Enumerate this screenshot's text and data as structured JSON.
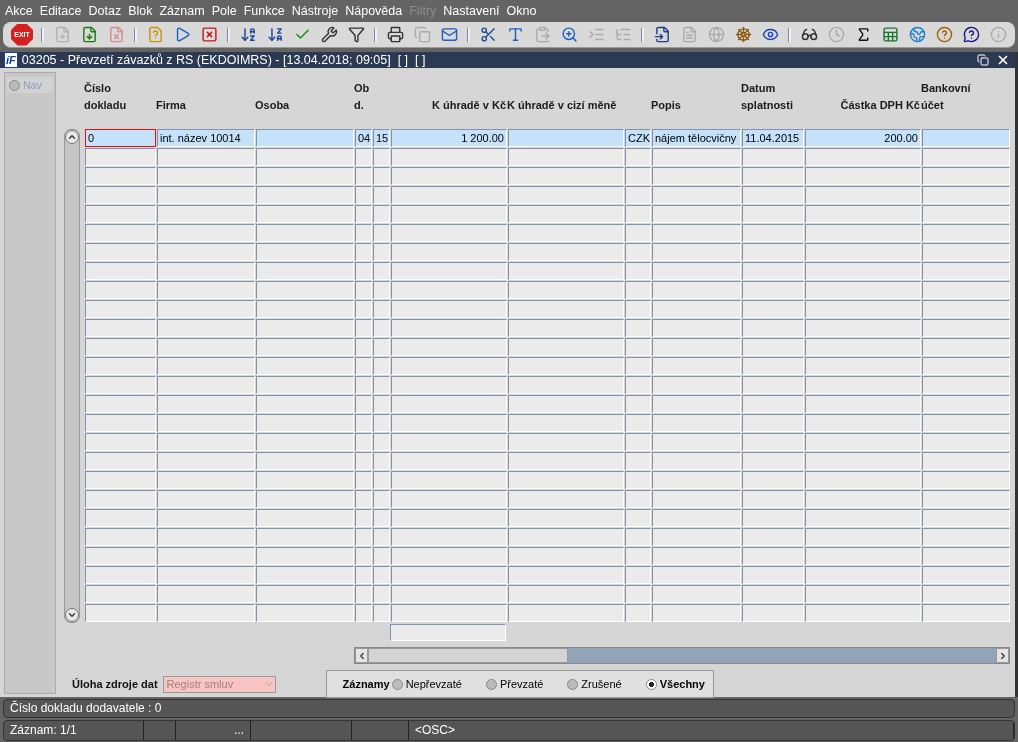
{
  "menu": [
    {
      "label": "Akce",
      "disabled": false
    },
    {
      "label": "Editace",
      "disabled": false
    },
    {
      "label": "Dotaz",
      "disabled": false
    },
    {
      "label": "Blok",
      "disabled": false
    },
    {
      "label": "Záznam",
      "disabled": false
    },
    {
      "label": "Pole",
      "disabled": false
    },
    {
      "label": "Funkce",
      "disabled": false
    },
    {
      "label": "Nástroje",
      "disabled": false
    },
    {
      "label": "Nápověda",
      "disabled": false
    },
    {
      "label": "Filtry",
      "disabled": true
    },
    {
      "label": "Nastavení",
      "disabled": false
    },
    {
      "label": "Okno",
      "disabled": false
    }
  ],
  "toolbar": [
    [
      {
        "kind": "exit",
        "label": "EXIT",
        "disabled": false
      }
    ],
    [
      {
        "kind": "insert",
        "disabled": true
      },
      {
        "kind": "save",
        "disabled": false
      },
      {
        "kind": "delete",
        "disabled": true
      }
    ],
    [
      {
        "kind": "query-enter",
        "disabled": false
      },
      {
        "kind": "query-execute",
        "disabled": false
      },
      {
        "kind": "query-cancel",
        "disabled": false
      }
    ],
    [
      {
        "kind": "sort-asc",
        "disabled": false
      },
      {
        "kind": "sort-desc",
        "disabled": false
      },
      {
        "kind": "check",
        "disabled": false
      },
      {
        "kind": "wrench",
        "disabled": false
      },
      {
        "kind": "filter",
        "disabled": false
      }
    ],
    [
      {
        "kind": "print",
        "disabled": false
      },
      {
        "kind": "copies",
        "disabled": true
      },
      {
        "kind": "mail",
        "disabled": false
      }
    ],
    [
      {
        "kind": "cut",
        "disabled": false
      },
      {
        "kind": "copy-text",
        "disabled": false
      },
      {
        "kind": "paste",
        "disabled": true
      },
      {
        "kind": "zoom",
        "disabled": false
      },
      {
        "kind": "list",
        "disabled": true
      },
      {
        "kind": "tree",
        "disabled": true
      }
    ],
    [
      {
        "kind": "import",
        "disabled": false
      },
      {
        "kind": "document",
        "disabled": true
      },
      {
        "kind": "globe",
        "disabled": true
      },
      {
        "kind": "wheel",
        "disabled": false
      },
      {
        "kind": "eye",
        "disabled": false
      }
    ],
    [
      {
        "kind": "glasses",
        "disabled": false
      },
      {
        "kind": "clock",
        "disabled": true
      },
      {
        "kind": "sigma",
        "disabled": false
      },
      {
        "kind": "sheet",
        "disabled": false
      },
      {
        "kind": "browser",
        "disabled": false
      },
      {
        "kind": "help-multi",
        "disabled": false
      },
      {
        "kind": "help",
        "disabled": false
      },
      {
        "kind": "info",
        "disabled": true
      }
    ]
  ],
  "window": {
    "logo": "íF",
    "title": "03205 - Převzetí závazků z RS (EKDOIMRS) - [13.04.2018; 09:05]  [ ]  [ ]"
  },
  "nav": {
    "label": "Nav",
    "selected": false
  },
  "table": {
    "columns": [
      {
        "label": "Číslo\ndokladu",
        "kind": "text"
      },
      {
        "label": "Firma",
        "kind": "text"
      },
      {
        "label": "Osoba",
        "kind": "text"
      },
      {
        "label": "Ob\nd.",
        "kind": "text"
      },
      {
        "kind": "text"
      },
      {
        "label": "K úhradě v Kč",
        "kind": "amount"
      },
      {
        "label": "K úhradě v cizí měně",
        "kind": "text"
      },
      {
        "kind": "text"
      },
      {
        "label": "Popis",
        "kind": "text"
      },
      {
        "label": "Datum\nsplatnosti",
        "kind": "text"
      },
      {
        "label": "Částka DPH Kč",
        "kind": "amount"
      },
      {
        "label": "Bankovní\núčet",
        "kind": "text"
      }
    ],
    "rows": [
      {
        "selected": true,
        "focused": true,
        "cells": [
          "0",
          "int. název 10014",
          null,
          "04",
          "15",
          "1 200.00",
          null,
          "CZK",
          "nájem tělocvičny",
          "11.04.2015",
          "200.00",
          null
        ]
      },
      {
        "selected": false,
        "focused": false
      },
      {
        "selected": false,
        "focused": false
      },
      {
        "selected": false,
        "focused": false
      },
      {
        "selected": false,
        "focused": false
      },
      {
        "selected": false,
        "focused": false
      },
      {
        "selected": false,
        "focused": false
      },
      {
        "selected": false,
        "focused": false
      },
      {
        "selected": false,
        "focused": false
      },
      {
        "selected": false,
        "focused": false
      },
      {
        "selected": false,
        "focused": false
      },
      {
        "selected": false,
        "focused": false
      },
      {
        "selected": false,
        "focused": false
      },
      {
        "selected": false,
        "focused": false
      },
      {
        "selected": false,
        "focused": false
      },
      {
        "selected": false,
        "focused": false
      },
      {
        "selected": false,
        "focused": false
      },
      {
        "selected": false,
        "focused": false
      },
      {
        "selected": false,
        "focused": false
      },
      {
        "selected": false,
        "focused": false
      },
      {
        "selected": false,
        "focused": false
      },
      {
        "selected": false,
        "focused": false
      },
      {
        "selected": false,
        "focused": false
      },
      {
        "selected": false,
        "focused": false
      },
      {
        "selected": false,
        "focused": false
      },
      {
        "selected": false,
        "focused": false
      }
    ]
  },
  "source": {
    "label": "Úloha zdroje dat",
    "value": "Registr smluv",
    "disabled": true
  },
  "records": {
    "label": "Záznamy",
    "options": [
      {
        "label": "Nepřevzaté",
        "selected": false
      },
      {
        "label": "Převzaté",
        "selected": false
      },
      {
        "label": "Zrušené",
        "selected": false
      },
      {
        "label": "Všechny",
        "selected": true
      }
    ]
  },
  "status_bar": {
    "message": "Číslo dokladu dodavatele : 0",
    "record": "Záznam: 1/1",
    "ellipsis": "...",
    "mode": "<OSC>"
  }
}
